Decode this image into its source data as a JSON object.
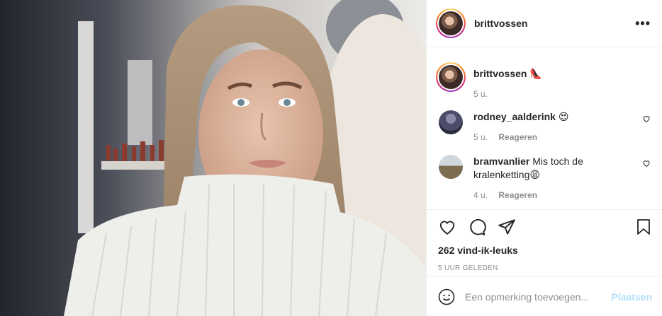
{
  "post": {
    "username": "brittvossen",
    "more_label": "•••"
  },
  "caption": {
    "username": "brittvossen",
    "text": "👠",
    "time": "5 u."
  },
  "comments": [
    {
      "username": "rodney_aalderink",
      "text": "😍",
      "time": "5 u.",
      "reply_label": "Reageren"
    },
    {
      "username": "bramvanlier",
      "text": "Mis toch de kralenketting😩",
      "time": "4 u.",
      "reply_label": "Reageren"
    }
  ],
  "likes": "262 vind-ik-leuks",
  "posted": "5 UUR GELEDEN",
  "add_comment": {
    "placeholder": "Een opmerking toevoegen...",
    "post_label": "Plaatsen"
  },
  "colors": {
    "link_disabled": "#b2dffc",
    "muted": "#8e8e8e",
    "border": "#efefef"
  }
}
